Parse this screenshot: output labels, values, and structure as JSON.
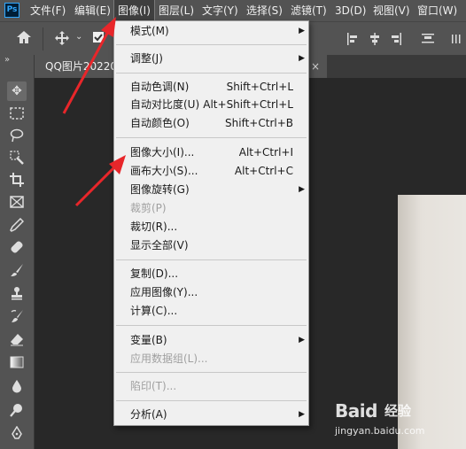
{
  "app": {
    "logo_text": "Ps"
  },
  "menubar": {
    "items": [
      {
        "label": "文件(F)"
      },
      {
        "label": "编辑(E)"
      },
      {
        "label": "图像(I)"
      },
      {
        "label": "图层(L)"
      },
      {
        "label": "文字(Y)"
      },
      {
        "label": "选择(S)"
      },
      {
        "label": "滤镜(T)"
      },
      {
        "label": "3D(D)"
      },
      {
        "label": "视图(V)"
      },
      {
        "label": "窗口(W)"
      }
    ],
    "active_item": "图像(I)"
  },
  "document": {
    "tab_label": "QQ图片20220",
    "close_glyph": "×"
  },
  "image_menu": {
    "items": [
      {
        "label": "模式(M)",
        "submenu": true
      },
      {
        "label": "调整(J)",
        "submenu": true
      },
      {
        "label": "自动色调(N)",
        "shortcut": "Shift+Ctrl+L"
      },
      {
        "label": "自动对比度(U)",
        "shortcut": "Alt+Shift+Ctrl+L"
      },
      {
        "label": "自动颜色(O)",
        "shortcut": "Shift+Ctrl+B"
      },
      {
        "label": "图像大小(I)...",
        "shortcut": "Alt+Ctrl+I"
      },
      {
        "label": "画布大小(S)...",
        "shortcut": "Alt+Ctrl+C"
      },
      {
        "label": "图像旋转(G)",
        "submenu": true
      },
      {
        "label": "裁剪(P)",
        "disabled": true
      },
      {
        "label": "裁切(R)..."
      },
      {
        "label": "显示全部(V)"
      },
      {
        "label": "复制(D)..."
      },
      {
        "label": "应用图像(Y)..."
      },
      {
        "label": "计算(C)..."
      },
      {
        "label": "变量(B)",
        "submenu": true
      },
      {
        "label": "应用数据组(L)...",
        "disabled": true
      },
      {
        "label": "陷印(T)...",
        "disabled": true
      },
      {
        "label": "分析(A)",
        "submenu": true
      }
    ]
  },
  "watermark": {
    "logo": "Baid",
    "sub": "经验",
    "url": "jingyan.baidu.com"
  },
  "colors": {
    "annotation_arrow": "#e8262a",
    "menu_bg": "#f0f0f0",
    "chrome": "#535353"
  }
}
